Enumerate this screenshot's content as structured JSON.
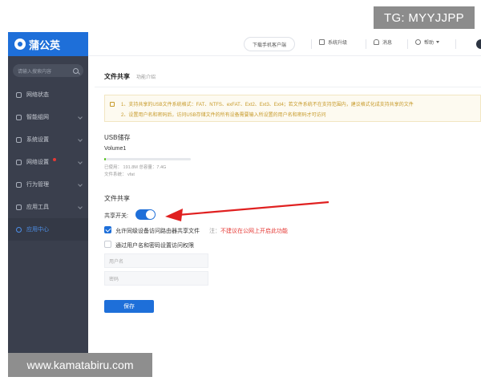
{
  "overlay": {
    "tg_badge": "TG: MYYJJPP",
    "watermark": "www.kamatabiru.com"
  },
  "sidebar": {
    "brand": "蒲公英",
    "search_placeholder": "请输入搜索内容",
    "items": [
      {
        "label": "网络状态",
        "icon": "network-status-icon"
      },
      {
        "label": "智能组网",
        "icon": "smart-network-icon"
      },
      {
        "label": "系统设置",
        "icon": "gear-icon"
      },
      {
        "label": "网络设置",
        "icon": "network-settings-icon",
        "badge": "red-dot"
      },
      {
        "label": "行为管理",
        "icon": "behavior-icon"
      },
      {
        "label": "应用工具",
        "icon": "tools-icon"
      },
      {
        "label": "应用中心",
        "icon": "app-center-icon",
        "active": true
      }
    ]
  },
  "topbar": {
    "download_client": "下载手机客户端",
    "system_upgrade": "系统升级",
    "messages": "消息",
    "help": "帮助"
  },
  "page": {
    "title": "文件共享",
    "subtitle": "功能介绍",
    "notice_1": "1、支持共享的USB文件系统格式：FAT、NTFS、exFAT、Ext2、Ext3、Ext4；若文件系统不在支持范围内，建议格式化成支持共享的文件",
    "notice_2": "2、设置用户名和密码后，访问USB存储文件的所有设备需要输入所设置的用户名和密码才可访问"
  },
  "usb": {
    "section_title": "USB储存",
    "volume": "Volume1",
    "used_fraction": 0.02,
    "used_text": "已使用： 191.8M    总容量：7.4G",
    "fs_text": "文件系统：  vfat"
  },
  "file_share": {
    "section_title": "文件共享",
    "switch_label": "共享开关:",
    "switch_on": true,
    "option_lan": "允许同级设备访问路由器共享文件",
    "note_prefix": "注：",
    "note_text": "不建议在公网上开启此功能",
    "option_auth": "通过用户名和密码设置访问权限",
    "username_placeholder": "用户名",
    "password_placeholder": "密码",
    "save_label": "保存"
  },
  "colors": {
    "primary": "#1e6fd9",
    "sidebar_bg": "#3a3f4d",
    "warning": "#c79a2a",
    "note_red": "#e53935",
    "arrow": "#e02020"
  }
}
